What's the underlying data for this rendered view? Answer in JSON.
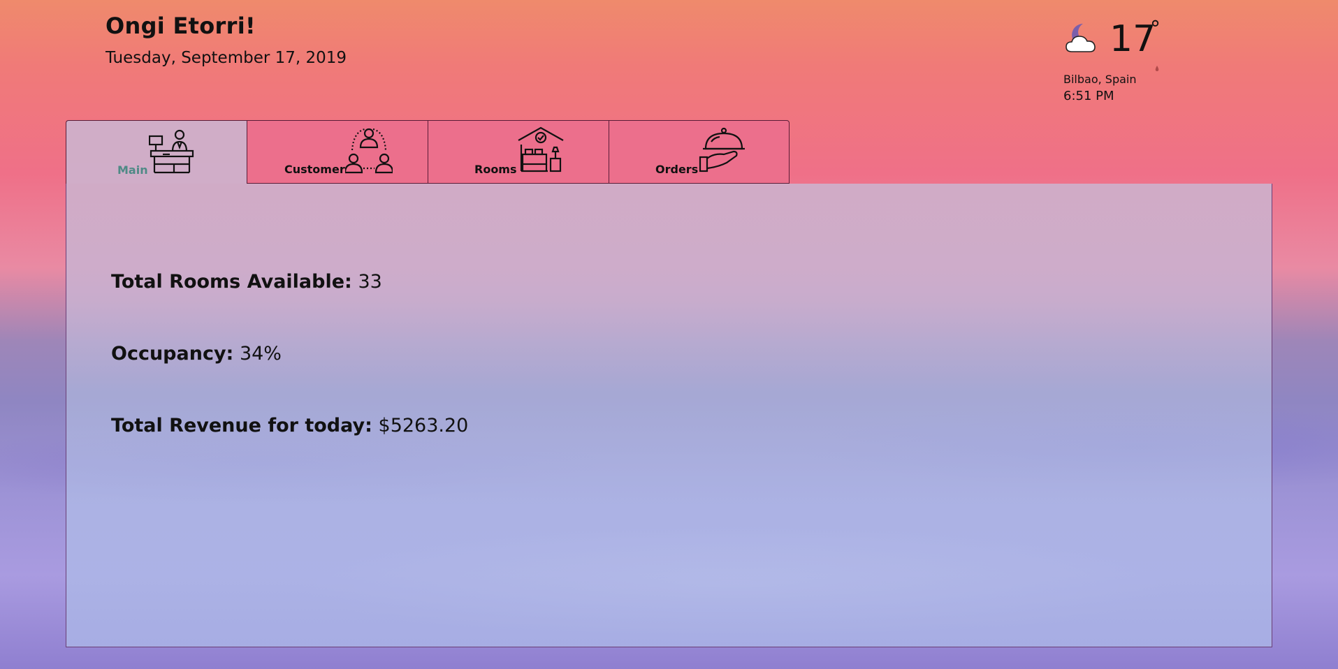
{
  "header": {
    "greeting": "Ongi Etorri!",
    "date": "Tuesday, September 17, 2019"
  },
  "weather": {
    "icon": "moon-cloud-icon",
    "temperature": "17",
    "degree_symbol": "°",
    "location": "Bilbao, Spain",
    "time": "6:51 PM"
  },
  "tabs": [
    {
      "label": "Main",
      "icon": "reception-desk-icon",
      "active": true
    },
    {
      "label": "Customer",
      "icon": "customer-group-icon",
      "active": false
    },
    {
      "label": "Rooms",
      "icon": "hotel-room-icon",
      "active": false
    },
    {
      "label": "Orders",
      "icon": "room-service-cloche-icon",
      "active": false
    }
  ],
  "stats": {
    "rooms_available": {
      "label": "Total Rooms Available:",
      "value": "33"
    },
    "occupancy": {
      "label": "Occupancy:",
      "value": "34%"
    },
    "revenue": {
      "label": "Total Revenue for today:",
      "value": "$5263.20"
    }
  },
  "colors": {
    "active_tab_label": "#4f8a86",
    "tab_background": "#ec6f8c",
    "tab_border": "#5a1c38"
  }
}
